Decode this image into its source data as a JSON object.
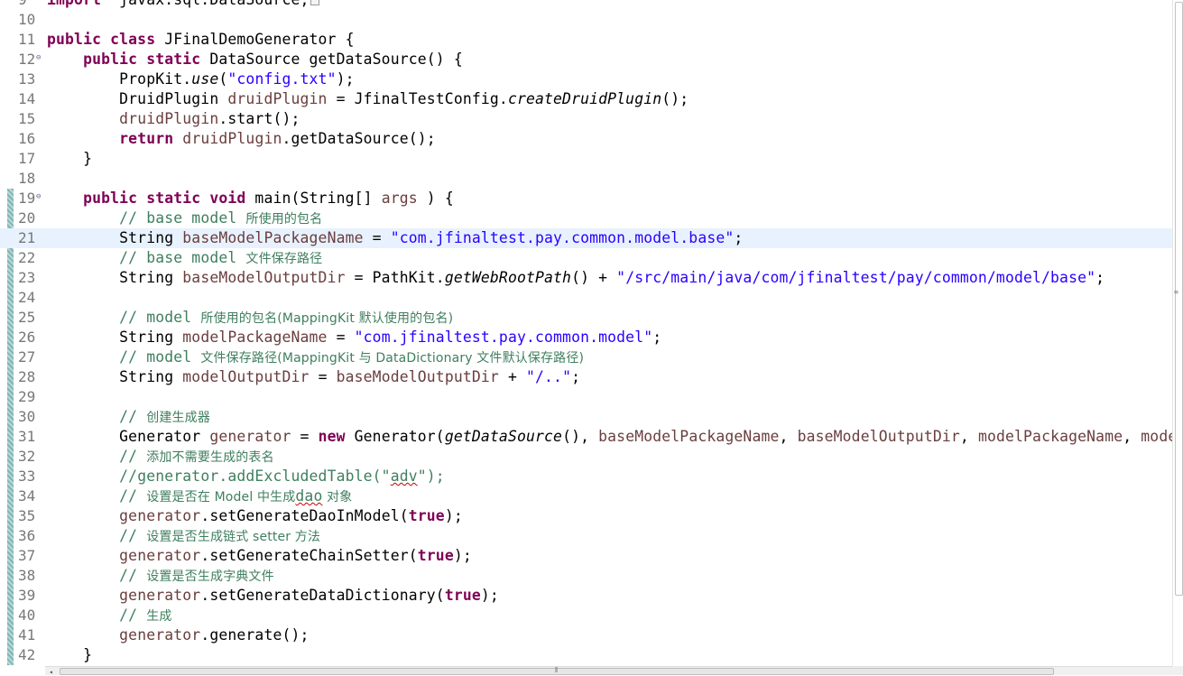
{
  "editor": {
    "lines": [
      {
        "num": "9",
        "fold": "⊕",
        "tokens": [
          [
            "kw",
            "import"
          ],
          [
            "",
            "  javax.sql.DataSource;"
          ],
          [
            "box",
            ""
          ]
        ]
      },
      {
        "num": "10",
        "tokens": []
      },
      {
        "num": "11",
        "tokens": [
          [
            "kw",
            "public class"
          ],
          [
            "",
            " JFinalDemoGenerator {"
          ]
        ]
      },
      {
        "num": "12",
        "fold": "⊖",
        "tokens": [
          [
            "",
            "    "
          ],
          [
            "kw",
            "public static"
          ],
          [
            "",
            " DataSource getDataSource() {"
          ]
        ]
      },
      {
        "num": "13",
        "tokens": [
          [
            "",
            "        PropKit."
          ],
          [
            "it",
            "use"
          ],
          [
            "",
            "("
          ],
          [
            "str",
            "\"config.txt\""
          ],
          [
            "",
            ");"
          ]
        ]
      },
      {
        "num": "14",
        "tokens": [
          [
            "",
            "        DruidPlugin "
          ],
          [
            "var",
            "druidPlugin"
          ],
          [
            "",
            " = JfinalTestConfig."
          ],
          [
            "it",
            "createDruidPlugin"
          ],
          [
            "",
            "();"
          ]
        ]
      },
      {
        "num": "15",
        "tokens": [
          [
            "",
            "        "
          ],
          [
            "var",
            "druidPlugin"
          ],
          [
            "",
            ".start();"
          ]
        ]
      },
      {
        "num": "16",
        "tokens": [
          [
            "",
            "        "
          ],
          [
            "kw",
            "return"
          ],
          [
            "",
            " "
          ],
          [
            "var",
            "druidPlugin"
          ],
          [
            "",
            ".getDataSource();"
          ]
        ]
      },
      {
        "num": "17",
        "tokens": [
          [
            "",
            "    }"
          ]
        ]
      },
      {
        "num": "18",
        "tokens": []
      },
      {
        "num": "19",
        "fold": "⊖",
        "tokens": [
          [
            "",
            "    "
          ],
          [
            "kw",
            "public static void"
          ],
          [
            "",
            " main(String[] "
          ],
          [
            "var",
            "args"
          ],
          [
            "",
            " ) {"
          ]
        ]
      },
      {
        "num": "20",
        "tokens": [
          [
            "",
            "        "
          ],
          [
            "cm",
            "// base model "
          ],
          [
            "cmcn",
            "所使用的包名"
          ]
        ]
      },
      {
        "num": "21",
        "current": true,
        "tokens": [
          [
            "",
            "        String "
          ],
          [
            "var",
            "baseModelPackageName"
          ],
          [
            "",
            " = "
          ],
          [
            "str",
            "\"com.jfinaltest.pay.common.model.base\""
          ],
          [
            "",
            ";"
          ]
        ]
      },
      {
        "num": "22",
        "tokens": [
          [
            "",
            "        "
          ],
          [
            "cm",
            "// base model "
          ],
          [
            "cmcn",
            "文件保存路径"
          ]
        ]
      },
      {
        "num": "23",
        "tokens": [
          [
            "",
            "        String "
          ],
          [
            "var",
            "baseModelOutputDir"
          ],
          [
            "",
            " = PathKit."
          ],
          [
            "it",
            "getWebRootPath"
          ],
          [
            "",
            "() + "
          ],
          [
            "str",
            "\"/src/main/java/com/jfinaltest/pay/common/model/base\""
          ],
          [
            "",
            ";"
          ]
        ]
      },
      {
        "num": "24",
        "tokens": []
      },
      {
        "num": "25",
        "tokens": [
          [
            "",
            "        "
          ],
          [
            "cm",
            "// model "
          ],
          [
            "cmcn",
            "所使用的包名(MappingKit 默认使用的包名)"
          ]
        ]
      },
      {
        "num": "26",
        "tokens": [
          [
            "",
            "        String "
          ],
          [
            "var",
            "modelPackageName"
          ],
          [
            "",
            " = "
          ],
          [
            "str",
            "\"com.jfinaltest.pay.common.model\""
          ],
          [
            "",
            ";"
          ]
        ]
      },
      {
        "num": "27",
        "tokens": [
          [
            "",
            "        "
          ],
          [
            "cm",
            "// model "
          ],
          [
            "cmcn",
            "文件保存路径(MappingKit 与 DataDictionary 文件默认保存路径)"
          ]
        ]
      },
      {
        "num": "28",
        "tokens": [
          [
            "",
            "        String "
          ],
          [
            "var",
            "modelOutputDir"
          ],
          [
            "",
            " = "
          ],
          [
            "var",
            "baseModelOutputDir"
          ],
          [
            "",
            " + "
          ],
          [
            "str",
            "\"/..\""
          ],
          [
            "",
            ";"
          ]
        ]
      },
      {
        "num": "29",
        "tokens": []
      },
      {
        "num": "30",
        "tokens": [
          [
            "",
            "        "
          ],
          [
            "cm",
            "// "
          ],
          [
            "cmcn",
            "创建生成器"
          ]
        ]
      },
      {
        "num": "31",
        "tokens": [
          [
            "",
            "        Generator "
          ],
          [
            "var",
            "generator"
          ],
          [
            "",
            " = "
          ],
          [
            "kw",
            "new"
          ],
          [
            "",
            " Generator("
          ],
          [
            "it",
            "getDataSource"
          ],
          [
            "",
            "(), "
          ],
          [
            "var",
            "baseModelPackageName"
          ],
          [
            "",
            ", "
          ],
          [
            "var",
            "baseModelOutputDir"
          ],
          [
            "",
            ", "
          ],
          [
            "var",
            "modelPackageName"
          ],
          [
            "",
            ", "
          ],
          [
            "var",
            "mode"
          ]
        ]
      },
      {
        "num": "32",
        "tokens": [
          [
            "",
            "        "
          ],
          [
            "cm",
            "// "
          ],
          [
            "cmcn",
            "添加不需要生成的表名"
          ]
        ]
      },
      {
        "num": "33",
        "tokens": [
          [
            "",
            "        "
          ],
          [
            "cm",
            "//generator.addExcludedTable(\""
          ],
          [
            "cmsq",
            "adv"
          ],
          [
            "cm",
            "\");"
          ]
        ]
      },
      {
        "num": "34",
        "tokens": [
          [
            "",
            "        "
          ],
          [
            "cm",
            "// "
          ],
          [
            "cmcn",
            "设置是否在 Model 中生成"
          ],
          [
            "cmsq",
            "dao"
          ],
          [
            "cmcn",
            " 对象"
          ]
        ]
      },
      {
        "num": "35",
        "tokens": [
          [
            "",
            "        "
          ],
          [
            "var",
            "generator"
          ],
          [
            "",
            ".setGenerateDaoInModel("
          ],
          [
            "kw",
            "true"
          ],
          [
            "",
            ");"
          ]
        ]
      },
      {
        "num": "36",
        "tokens": [
          [
            "",
            "        "
          ],
          [
            "cm",
            "// "
          ],
          [
            "cmcn",
            "设置是否生成链式 setter 方法"
          ]
        ]
      },
      {
        "num": "37",
        "tokens": [
          [
            "",
            "        "
          ],
          [
            "var",
            "generator"
          ],
          [
            "",
            ".setGenerateChainSetter("
          ],
          [
            "kw",
            "true"
          ],
          [
            "",
            ");"
          ]
        ]
      },
      {
        "num": "38",
        "tokens": [
          [
            "",
            "        "
          ],
          [
            "cm",
            "// "
          ],
          [
            "cmcn",
            "设置是否生成字典文件"
          ]
        ]
      },
      {
        "num": "39",
        "tokens": [
          [
            "",
            "        "
          ],
          [
            "var",
            "generator"
          ],
          [
            "",
            ".setGenerateDataDictionary("
          ],
          [
            "kw",
            "true"
          ],
          [
            "",
            ");"
          ]
        ]
      },
      {
        "num": "40",
        "tokens": [
          [
            "",
            "        "
          ],
          [
            "cm",
            "// "
          ],
          [
            "cmcn",
            "生成"
          ]
        ]
      },
      {
        "num": "41",
        "tokens": [
          [
            "",
            "        "
          ],
          [
            "var",
            "generator"
          ],
          [
            "",
            ".generate();"
          ]
        ]
      },
      {
        "num": "42",
        "tokens": [
          [
            "",
            "    }"
          ]
        ]
      }
    ]
  },
  "colors": {
    "keyword": "#7f0055",
    "string": "#2a00ff",
    "comment": "#3f7f5f",
    "variable": "#6a3e3e",
    "current_line": "#e8f2fe"
  }
}
